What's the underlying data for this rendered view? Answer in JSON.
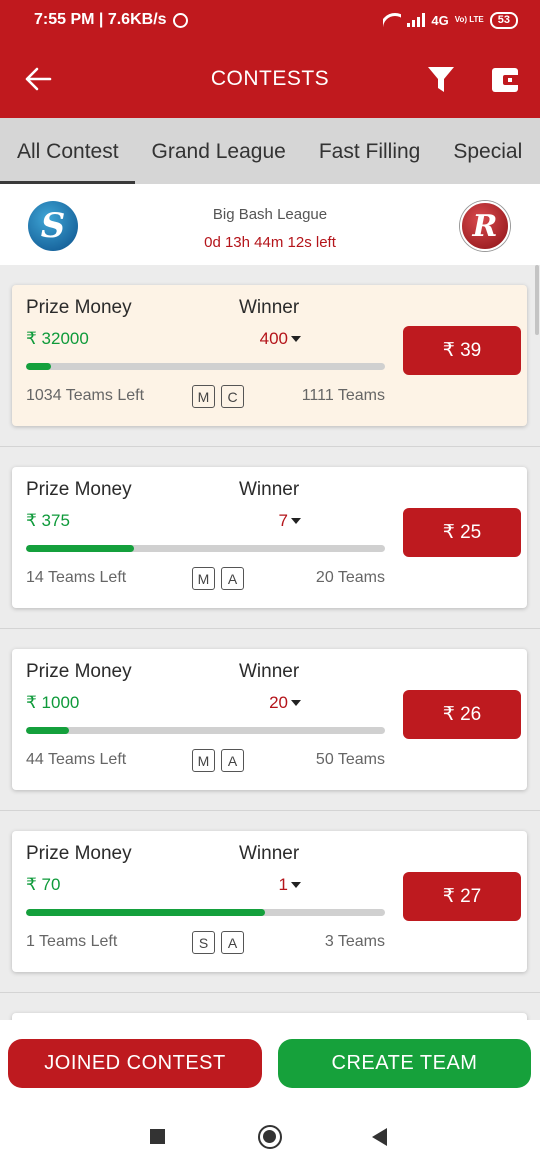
{
  "status_bar": {
    "time_speed": "7:55 PM | 7.6KB/s",
    "network": "4G",
    "network_sub": "Vo) LTE",
    "battery": "53"
  },
  "app_bar": {
    "title": "CONTESTS",
    "icons": [
      "back-arrow-icon",
      "filter-icon",
      "wallet-icon"
    ]
  },
  "tabs": [
    {
      "label": "All Contest",
      "active": true
    },
    {
      "label": "Grand League",
      "active": false
    },
    {
      "label": "Fast Filling",
      "active": false
    },
    {
      "label": "Special",
      "active": false
    }
  ],
  "match": {
    "league": "Big Bash League",
    "time_left": "0d 13h 44m 12s left",
    "home_logo_letter": "S",
    "away_logo_letter": "R"
  },
  "contest_labels": {
    "prize_label": "Prize Money",
    "winner_label": "Winner"
  },
  "contests": [
    {
      "prize": "₹ 32000",
      "winners": "400",
      "fill_fraction": 0.069,
      "teams_left": "1034 Teams Left",
      "badges": [
        "M",
        "C"
      ],
      "total": "1111 Teams",
      "fee": "₹ 39",
      "highlight": true
    },
    {
      "prize": "₹ 375",
      "winners": "7",
      "fill_fraction": 0.3,
      "teams_left": "14 Teams Left",
      "badges": [
        "M",
        "A"
      ],
      "total": "20 Teams",
      "fee": "₹ 25",
      "highlight": false
    },
    {
      "prize": "₹ 1000",
      "winners": "20",
      "fill_fraction": 0.12,
      "teams_left": "44 Teams Left",
      "badges": [
        "M",
        "A"
      ],
      "total": "50 Teams",
      "fee": "₹ 26",
      "highlight": false
    },
    {
      "prize": "₹ 70",
      "winners": "1",
      "fill_fraction": 0.667,
      "teams_left": "1 Teams Left",
      "badges": [
        "S",
        "A"
      ],
      "total": "3 Teams",
      "fee": "₹ 27",
      "highlight": false
    }
  ],
  "actions": {
    "joined_label": "JOINED CONTEST",
    "create_label": "CREATE TEAM"
  },
  "colors": {
    "brand_red": "#c0191e",
    "prize_green": "#0e9a3a",
    "create_green": "#16a13b"
  }
}
